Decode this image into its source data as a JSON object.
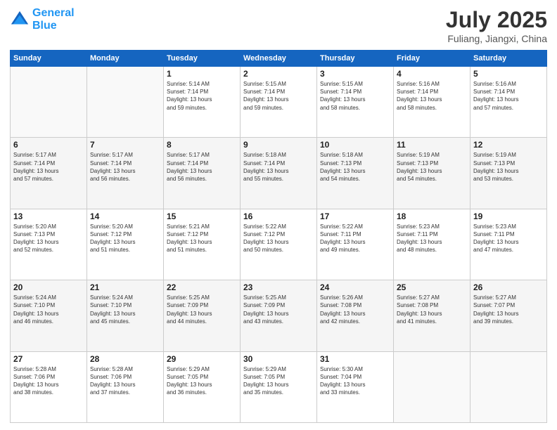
{
  "header": {
    "logo_line1": "General",
    "logo_line2": "Blue",
    "month_year": "July 2025",
    "location": "Fuliang, Jiangxi, China"
  },
  "weekdays": [
    "Sunday",
    "Monday",
    "Tuesday",
    "Wednesday",
    "Thursday",
    "Friday",
    "Saturday"
  ],
  "weeks": [
    [
      {
        "day": "",
        "info": ""
      },
      {
        "day": "",
        "info": ""
      },
      {
        "day": "1",
        "info": "Sunrise: 5:14 AM\nSunset: 7:14 PM\nDaylight: 13 hours\nand 59 minutes."
      },
      {
        "day": "2",
        "info": "Sunrise: 5:15 AM\nSunset: 7:14 PM\nDaylight: 13 hours\nand 59 minutes."
      },
      {
        "day": "3",
        "info": "Sunrise: 5:15 AM\nSunset: 7:14 PM\nDaylight: 13 hours\nand 58 minutes."
      },
      {
        "day": "4",
        "info": "Sunrise: 5:16 AM\nSunset: 7:14 PM\nDaylight: 13 hours\nand 58 minutes."
      },
      {
        "day": "5",
        "info": "Sunrise: 5:16 AM\nSunset: 7:14 PM\nDaylight: 13 hours\nand 57 minutes."
      }
    ],
    [
      {
        "day": "6",
        "info": "Sunrise: 5:17 AM\nSunset: 7:14 PM\nDaylight: 13 hours\nand 57 minutes."
      },
      {
        "day": "7",
        "info": "Sunrise: 5:17 AM\nSunset: 7:14 PM\nDaylight: 13 hours\nand 56 minutes."
      },
      {
        "day": "8",
        "info": "Sunrise: 5:17 AM\nSunset: 7:14 PM\nDaylight: 13 hours\nand 56 minutes."
      },
      {
        "day": "9",
        "info": "Sunrise: 5:18 AM\nSunset: 7:14 PM\nDaylight: 13 hours\nand 55 minutes."
      },
      {
        "day": "10",
        "info": "Sunrise: 5:18 AM\nSunset: 7:13 PM\nDaylight: 13 hours\nand 54 minutes."
      },
      {
        "day": "11",
        "info": "Sunrise: 5:19 AM\nSunset: 7:13 PM\nDaylight: 13 hours\nand 54 minutes."
      },
      {
        "day": "12",
        "info": "Sunrise: 5:19 AM\nSunset: 7:13 PM\nDaylight: 13 hours\nand 53 minutes."
      }
    ],
    [
      {
        "day": "13",
        "info": "Sunrise: 5:20 AM\nSunset: 7:13 PM\nDaylight: 13 hours\nand 52 minutes."
      },
      {
        "day": "14",
        "info": "Sunrise: 5:20 AM\nSunset: 7:12 PM\nDaylight: 13 hours\nand 51 minutes."
      },
      {
        "day": "15",
        "info": "Sunrise: 5:21 AM\nSunset: 7:12 PM\nDaylight: 13 hours\nand 51 minutes."
      },
      {
        "day": "16",
        "info": "Sunrise: 5:22 AM\nSunset: 7:12 PM\nDaylight: 13 hours\nand 50 minutes."
      },
      {
        "day": "17",
        "info": "Sunrise: 5:22 AM\nSunset: 7:11 PM\nDaylight: 13 hours\nand 49 minutes."
      },
      {
        "day": "18",
        "info": "Sunrise: 5:23 AM\nSunset: 7:11 PM\nDaylight: 13 hours\nand 48 minutes."
      },
      {
        "day": "19",
        "info": "Sunrise: 5:23 AM\nSunset: 7:11 PM\nDaylight: 13 hours\nand 47 minutes."
      }
    ],
    [
      {
        "day": "20",
        "info": "Sunrise: 5:24 AM\nSunset: 7:10 PM\nDaylight: 13 hours\nand 46 minutes."
      },
      {
        "day": "21",
        "info": "Sunrise: 5:24 AM\nSunset: 7:10 PM\nDaylight: 13 hours\nand 45 minutes."
      },
      {
        "day": "22",
        "info": "Sunrise: 5:25 AM\nSunset: 7:09 PM\nDaylight: 13 hours\nand 44 minutes."
      },
      {
        "day": "23",
        "info": "Sunrise: 5:25 AM\nSunset: 7:09 PM\nDaylight: 13 hours\nand 43 minutes."
      },
      {
        "day": "24",
        "info": "Sunrise: 5:26 AM\nSunset: 7:08 PM\nDaylight: 13 hours\nand 42 minutes."
      },
      {
        "day": "25",
        "info": "Sunrise: 5:27 AM\nSunset: 7:08 PM\nDaylight: 13 hours\nand 41 minutes."
      },
      {
        "day": "26",
        "info": "Sunrise: 5:27 AM\nSunset: 7:07 PM\nDaylight: 13 hours\nand 39 minutes."
      }
    ],
    [
      {
        "day": "27",
        "info": "Sunrise: 5:28 AM\nSunset: 7:06 PM\nDaylight: 13 hours\nand 38 minutes."
      },
      {
        "day": "28",
        "info": "Sunrise: 5:28 AM\nSunset: 7:06 PM\nDaylight: 13 hours\nand 37 minutes."
      },
      {
        "day": "29",
        "info": "Sunrise: 5:29 AM\nSunset: 7:05 PM\nDaylight: 13 hours\nand 36 minutes."
      },
      {
        "day": "30",
        "info": "Sunrise: 5:29 AM\nSunset: 7:05 PM\nDaylight: 13 hours\nand 35 minutes."
      },
      {
        "day": "31",
        "info": "Sunrise: 5:30 AM\nSunset: 7:04 PM\nDaylight: 13 hours\nand 33 minutes."
      },
      {
        "day": "",
        "info": ""
      },
      {
        "day": "",
        "info": ""
      }
    ]
  ]
}
